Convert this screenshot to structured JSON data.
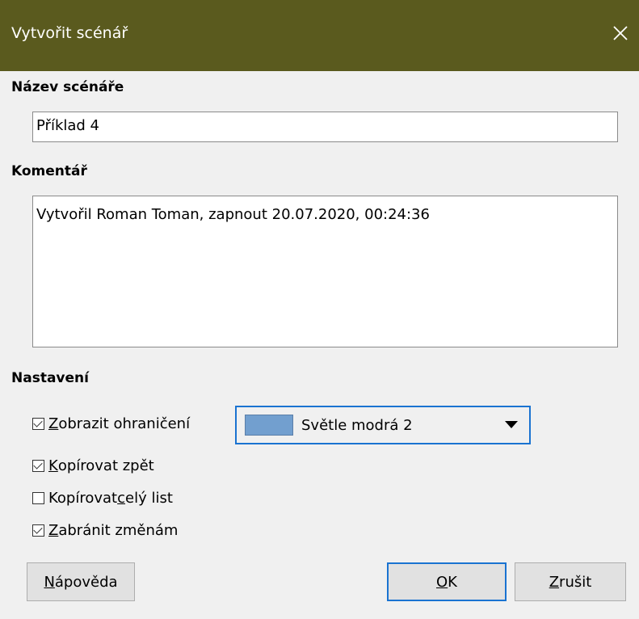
{
  "window": {
    "title": "Vytvořit scénář"
  },
  "name_section": {
    "heading": "Název scénáře",
    "value": "Příklad  4"
  },
  "comment_section": {
    "heading": "Komentář",
    "value": "Vytvořil Roman Toman, zapnout 20.07.2020, 00:24:36"
  },
  "settings": {
    "heading": "Nastavení",
    "show_border": {
      "mnemonic": "Z",
      "rest": "obrazit ohraničení",
      "checked": true
    },
    "border_color": {
      "label": "Světle modrá 2",
      "swatch": "#729fcf"
    },
    "copy_back": {
      "mnemonic": "K",
      "rest": "opírovat zpět",
      "checked": true
    },
    "copy_sheet": {
      "pre": "Kopírovat ",
      "mnemonic": "c",
      "rest": "elý list",
      "checked": false
    },
    "prevent_changes": {
      "mnemonic": "Z",
      "rest": "abránit změnám",
      "checked": true
    }
  },
  "buttons": {
    "help": {
      "mnemonic": "N",
      "rest": "ápověda"
    },
    "ok": {
      "mnemonic": "O",
      "rest": "K"
    },
    "cancel": {
      "mnemonic": "Z",
      "rest": "rušit"
    }
  },
  "colors": {
    "titlebar": "#5a5a1e",
    "focus": "#1a73d1"
  }
}
